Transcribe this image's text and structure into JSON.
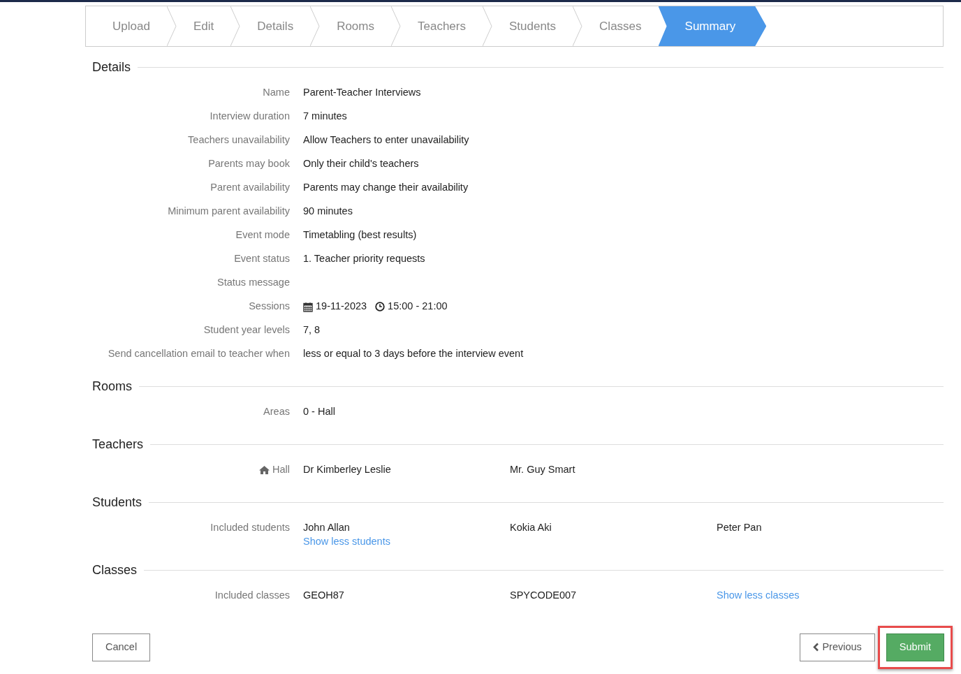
{
  "steps": [
    {
      "label": "Upload",
      "selected": false
    },
    {
      "label": "Edit",
      "selected": false
    },
    {
      "label": "Details",
      "selected": false
    },
    {
      "label": "Rooms",
      "selected": false
    },
    {
      "label": "Teachers",
      "selected": false
    },
    {
      "label": "Students",
      "selected": false
    },
    {
      "label": "Classes",
      "selected": false
    },
    {
      "label": "Summary",
      "selected": true
    }
  ],
  "sections": [
    {
      "title": "Details",
      "rows": [
        {
          "label": "Name",
          "values": [
            "Parent-Teacher Interviews"
          ]
        },
        {
          "label": "Interview duration",
          "values": [
            "7 minutes"
          ]
        },
        {
          "label": "Teachers unavailability",
          "values": [
            "Allow Teachers to enter unavailability"
          ]
        },
        {
          "label": "Parents may book",
          "values": [
            "Only their child's teachers"
          ]
        },
        {
          "label": "Parent availability",
          "values": [
            "Parents may change their availability"
          ]
        },
        {
          "label": "Minimum parent availability",
          "values": [
            "90 minutes"
          ]
        },
        {
          "label": "Event mode",
          "values": [
            "Timetabling (best results)"
          ]
        },
        {
          "label": "Event status",
          "values": [
            "1. Teacher priority requests"
          ]
        },
        {
          "label": "Status message",
          "values": []
        },
        {
          "label": "Sessions",
          "kind": "session",
          "date": "19-11-2023",
          "time": "15:00 - 21:00"
        },
        {
          "label": "Student year levels",
          "values": [
            "7, 8"
          ]
        },
        {
          "label": "Send cancellation email to teacher when",
          "values": [
            "less or equal to 3 days before the interview event"
          ]
        }
      ]
    },
    {
      "title": "Rooms",
      "rows": [
        {
          "label": "Areas",
          "values": [
            "0 - Hall"
          ]
        }
      ]
    },
    {
      "title": "Teachers",
      "rows": [
        {
          "label": "Hall",
          "kind": "room",
          "values": [
            "Dr Kimberley Leslie",
            "Mr. Guy Smart"
          ]
        }
      ]
    },
    {
      "title": "Students",
      "rows": [
        {
          "label": "Included students",
          "values": [
            "John Allan",
            "Kokia Aki",
            "Peter Pan"
          ],
          "link": "Show less students"
        }
      ]
    },
    {
      "title": "Classes",
      "rows": [
        {
          "label": "Included classes",
          "values": [
            "GEOH87",
            "SPYCODE007"
          ],
          "inline_link": "Show less classes"
        }
      ]
    }
  ],
  "buttons": {
    "cancel": "Cancel",
    "previous": "Previous",
    "submit": "Submit",
    "submit_highlighted": true
  }
}
